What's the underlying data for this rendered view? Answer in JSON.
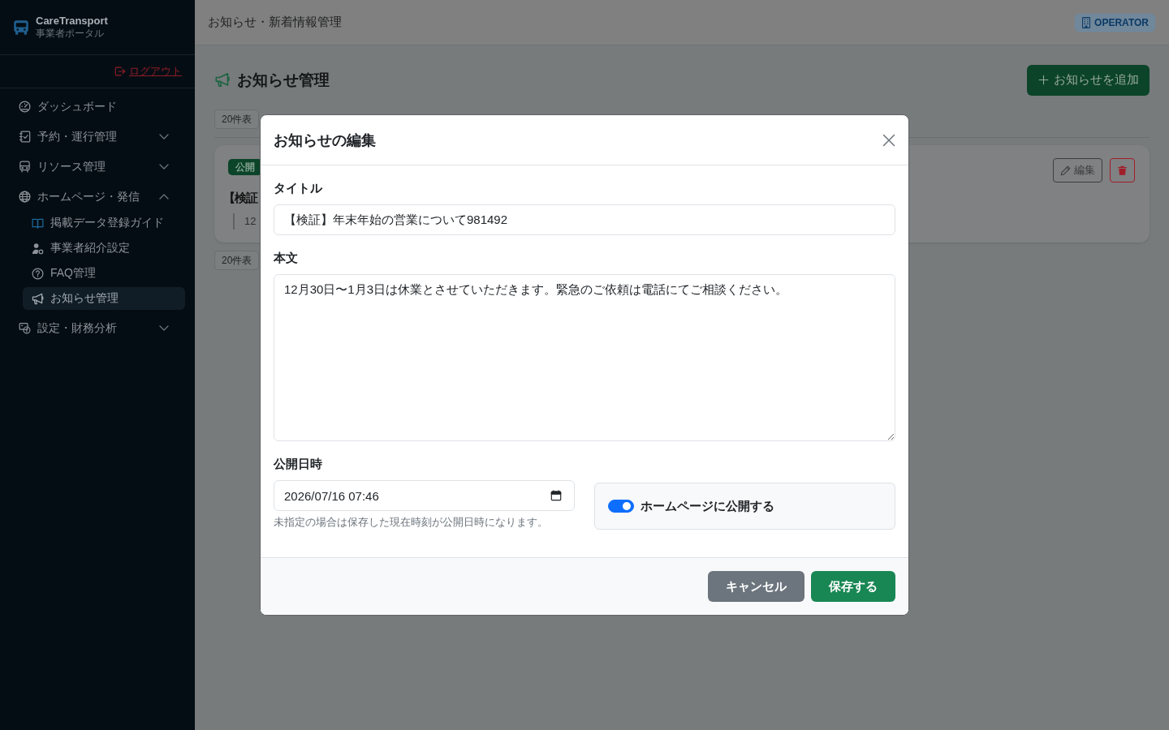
{
  "sidebar": {
    "brand": {
      "name": "CareTransport",
      "subtitle": "事業者ポータル"
    },
    "logout": "ログアウト",
    "items": [
      {
        "kind": "link",
        "label": "ダッシュボード",
        "selected": false
      },
      {
        "kind": "group",
        "label": "予約・運行管理",
        "selected": false,
        "expanded": false
      },
      {
        "kind": "group",
        "label": "リソース管理",
        "selected": false,
        "expanded": false
      },
      {
        "kind": "group",
        "label": "ホームページ・発信",
        "selected": false,
        "expanded": true,
        "children": [
          {
            "label": "掲載データ登録ガイド",
            "selected": false
          },
          {
            "label": "事業者紹介設定",
            "selected": false
          },
          {
            "label": "FAQ管理",
            "selected": false
          },
          {
            "label": "お知らせ管理",
            "selected": true
          }
        ]
      },
      {
        "kind": "group",
        "label": "設定・財務分析",
        "selected": false,
        "expanded": false
      }
    ]
  },
  "header": {
    "title": "お知らせ・新着情報管理",
    "role_badge": "OPERATOR"
  },
  "page": {
    "title": "お知らせ管理",
    "add_button": "お知らせを追加",
    "page_size_button": "20件表",
    "notices": [
      {
        "status": "公開",
        "title": "【検証",
        "excerpt": "12",
        "edit_button": "編集"
      }
    ],
    "pager_button": "20件表"
  },
  "modal": {
    "title": "お知らせの編集",
    "fields": [
      {
        "kind": "text",
        "label": "タイトル",
        "value": "【検証】年末年始の営業について981492"
      },
      {
        "kind": "textarea",
        "label": "本文",
        "value": "12月30日〜1月3日は休業とさせていただきます。緊急のご依頼は電話にてご相談ください。"
      }
    ],
    "publish_date": {
      "label": "公開日時",
      "value": "2026/07/16 07:46",
      "help": "未指定の場合は保存した現在時刻が公開日時になります。"
    },
    "publish_toggle": {
      "label": "ホームページに公開する",
      "on": true
    },
    "buttons": [
      {
        "kind": "secondary",
        "label": "キャンセル"
      },
      {
        "kind": "primary",
        "label": "保存する"
      }
    ]
  }
}
